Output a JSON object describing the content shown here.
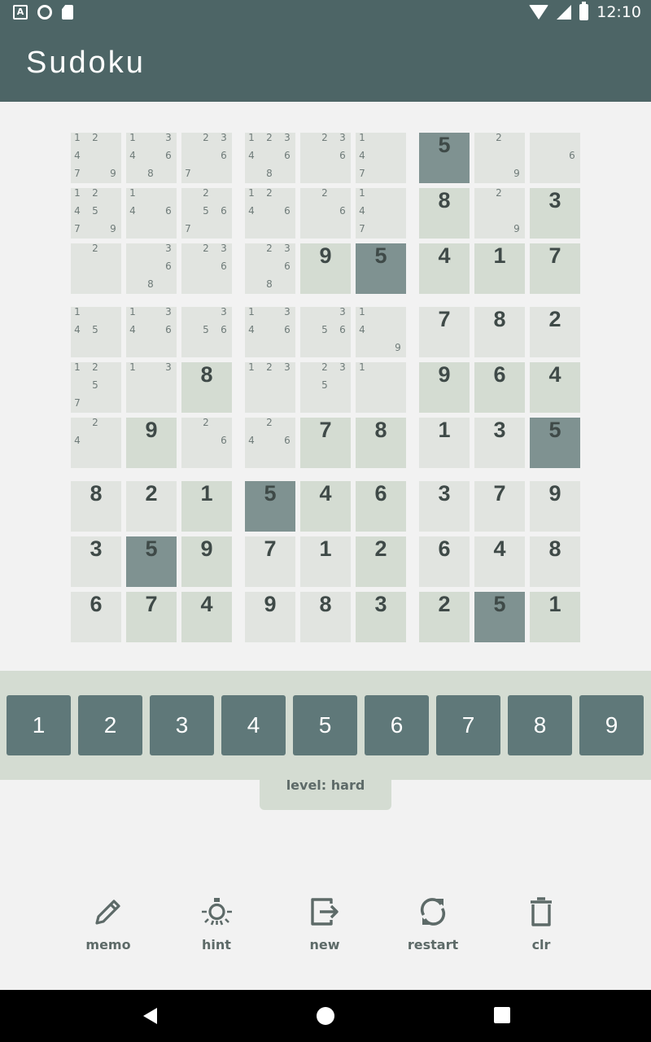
{
  "status_bar": {
    "time": "12:10"
  },
  "app_bar": {
    "title": "Sudoku"
  },
  "board": {
    "cells": [
      [
        {
          "m": [
            1,
            2,
            4,
            7,
            9
          ]
        },
        {
          "m": [
            1,
            3,
            4,
            6,
            8
          ]
        },
        {
          "m": [
            2,
            3,
            6,
            7
          ]
        },
        {
          "m": [
            1,
            2,
            3,
            4,
            6,
            8
          ]
        },
        {
          "m": [
            2,
            3,
            6
          ]
        },
        {
          "m": [
            1,
            4,
            7
          ]
        },
        {
          "v": 5,
          "s": "dark"
        },
        {
          "m": [
            2,
            9
          ]
        },
        {
          "m": [
            6
          ]
        }
      ],
      [
        {
          "m": [
            1,
            2,
            4,
            5,
            7,
            9
          ]
        },
        {
          "m": [
            1,
            4,
            6
          ]
        },
        {
          "m": [
            2,
            5,
            6,
            7
          ]
        },
        {
          "m": [
            1,
            2,
            4,
            6
          ]
        },
        {
          "m": [
            2,
            6
          ]
        },
        {
          "m": [
            1,
            4,
            7
          ]
        },
        {
          "v": 8,
          "s": "green"
        },
        {
          "m": [
            2,
            9
          ]
        },
        {
          "v": 3,
          "s": "green"
        }
      ],
      [
        {
          "m": [
            2
          ]
        },
        {
          "m": [
            3,
            6,
            8
          ]
        },
        {
          "m": [
            2,
            3,
            6
          ]
        },
        {
          "m": [
            2,
            3,
            6,
            8
          ]
        },
        {
          "v": 9,
          "s": "green"
        },
        {
          "v": 5,
          "s": "dark"
        },
        {
          "v": 4,
          "s": "green"
        },
        {
          "v": 1,
          "s": "green"
        },
        {
          "v": 7,
          "s": "green"
        }
      ],
      [
        {
          "m": [
            1,
            4,
            5
          ]
        },
        {
          "m": [
            1,
            3,
            4,
            6
          ]
        },
        {
          "m": [
            3,
            5,
            6
          ]
        },
        {
          "m": [
            1,
            3,
            4,
            6
          ]
        },
        {
          "m": [
            3,
            5,
            6
          ]
        },
        {
          "m": [
            1,
            4,
            9
          ]
        },
        {
          "v": 7,
          "s": "light"
        },
        {
          "v": 8,
          "s": "light"
        },
        {
          "v": 2,
          "s": "light"
        }
      ],
      [
        {
          "m": [
            1,
            2,
            5,
            7
          ]
        },
        {
          "m": [
            1,
            3
          ]
        },
        {
          "v": 8,
          "s": "green"
        },
        {
          "m": [
            1,
            2,
            3
          ]
        },
        {
          "m": [
            2,
            3,
            5
          ]
        },
        {
          "m": [
            1
          ]
        },
        {
          "v": 9,
          "s": "green"
        },
        {
          "v": 6,
          "s": "green"
        },
        {
          "v": 4,
          "s": "green"
        }
      ],
      [
        {
          "m": [
            2,
            4
          ]
        },
        {
          "v": 9,
          "s": "green"
        },
        {
          "m": [
            2,
            6
          ]
        },
        {
          "m": [
            2,
            4,
            6
          ]
        },
        {
          "v": 7,
          "s": "green"
        },
        {
          "v": 8,
          "s": "green"
        },
        {
          "v": 1,
          "s": "light"
        },
        {
          "v": 3,
          "s": "light"
        },
        {
          "v": 5,
          "s": "dark"
        }
      ],
      [
        {
          "v": 8,
          "s": "light"
        },
        {
          "v": 2,
          "s": "light"
        },
        {
          "v": 1,
          "s": "green"
        },
        {
          "v": 5,
          "s": "dark"
        },
        {
          "v": 4,
          "s": "green"
        },
        {
          "v": 6,
          "s": "green"
        },
        {
          "v": 3,
          "s": "light"
        },
        {
          "v": 7,
          "s": "light"
        },
        {
          "v": 9,
          "s": "light"
        }
      ],
      [
        {
          "v": 3,
          "s": "light"
        },
        {
          "v": 5,
          "s": "dark"
        },
        {
          "v": 9,
          "s": "green"
        },
        {
          "v": 7,
          "s": "light"
        },
        {
          "v": 1,
          "s": "light"
        },
        {
          "v": 2,
          "s": "green"
        },
        {
          "v": 6,
          "s": "light"
        },
        {
          "v": 4,
          "s": "light"
        },
        {
          "v": 8,
          "s": "light"
        }
      ],
      [
        {
          "v": 6,
          "s": "light"
        },
        {
          "v": 7,
          "s": "green"
        },
        {
          "v": 4,
          "s": "green"
        },
        {
          "v": 9,
          "s": "light"
        },
        {
          "v": 8,
          "s": "light"
        },
        {
          "v": 3,
          "s": "green"
        },
        {
          "v": 2,
          "s": "green"
        },
        {
          "v": 5,
          "s": "dark"
        },
        {
          "v": 1,
          "s": "green"
        }
      ]
    ]
  },
  "numpad": {
    "buttons": [
      "1",
      "2",
      "3",
      "4",
      "5",
      "6",
      "7",
      "8",
      "9"
    ]
  },
  "level": {
    "label": "level: hard"
  },
  "tools": {
    "memo": {
      "label": "memo",
      "icon": "pencil-icon"
    },
    "hint": {
      "label": "hint",
      "icon": "lightbulb-icon"
    },
    "new": {
      "label": "new",
      "icon": "exit-icon"
    },
    "restart": {
      "label": "restart",
      "icon": "refresh-icon"
    },
    "clr": {
      "label": "clr",
      "icon": "trash-icon"
    }
  },
  "nav_bar": {
    "back": "back-icon",
    "home": "home-icon",
    "recents": "recents-icon"
  },
  "colors": {
    "primary": "#4d6566",
    "button": "#5f7879",
    "cell_light": "#e1e4e0",
    "cell_green": "#d4dcd2",
    "cell_dark": "#7f9291"
  }
}
